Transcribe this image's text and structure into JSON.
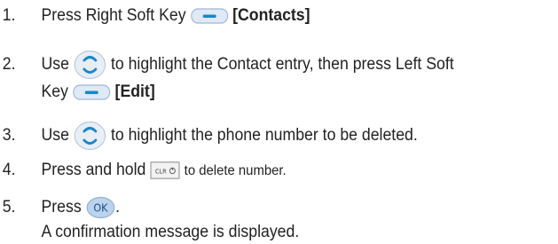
{
  "steps": [
    {
      "num": "1.",
      "pre": "Press Right Soft Key",
      "key": "[Contacts]",
      "icon": "soft-key-icon"
    },
    {
      "num": "2.",
      "pre": "Use",
      "post": "to highlight the Contact entry, then press Left Soft",
      "line2_pre": "Key",
      "key": "[Edit]",
      "icons": [
        "navigation-key-icon",
        "soft-key-icon"
      ]
    },
    {
      "num": "3.",
      "pre": "Use",
      "post": "to highlight the phone number to be deleted.",
      "icon": "navigation-key-icon"
    },
    {
      "num": "4.",
      "pre": "Press and hold",
      "post": "to delete number.",
      "icon": "clear-key-icon",
      "clear_key_label": "CLR"
    },
    {
      "num": "5.",
      "pre": "Press",
      "post": ".",
      "icon": "ok-key-icon",
      "ok_key_label": "OK",
      "note": "A confirmation message is displayed."
    }
  ],
  "colors": {
    "key_blue": "#1a86c9",
    "key_fill": "#dfeaf6",
    "text": "#222222"
  }
}
